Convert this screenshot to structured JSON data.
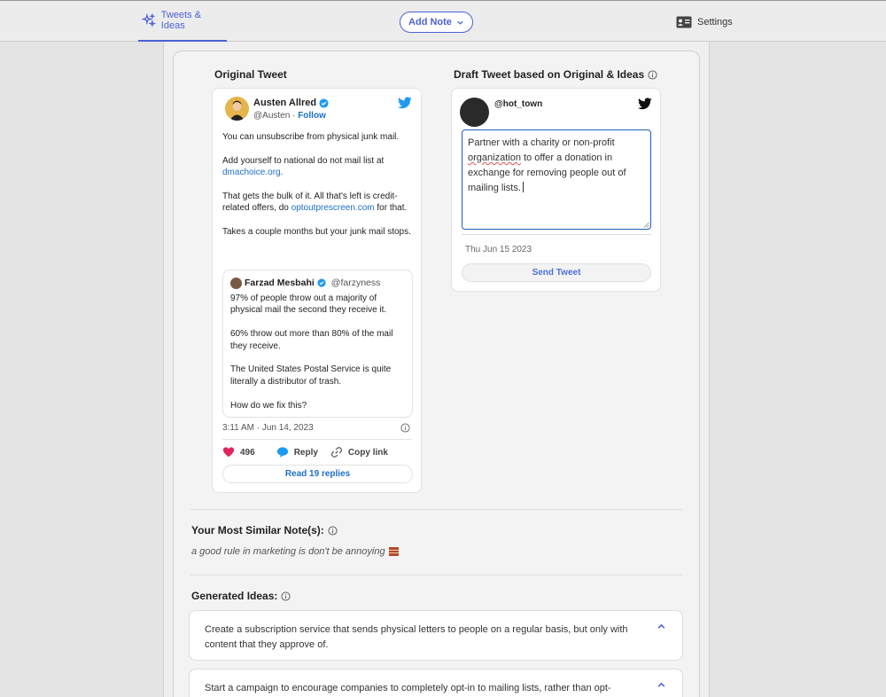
{
  "nav": {
    "tab_label": "Tweets & Ideas",
    "add_note_label": "Add Note",
    "settings_label": "Settings"
  },
  "original": {
    "heading": "Original Tweet",
    "author_name": "Austen Allred",
    "author_handle": "@Austen",
    "follow_label": "Follow",
    "body": {
      "p1": "You can unsubscribe from physical junk mail.",
      "p2_text": "Add yourself to national do not mail list at ",
      "p2_link": "dmachoice.org",
      "p2_end": ".",
      "p3_text": "That gets the bulk of it. All that's left is credit-related offers, do ",
      "p3_link": "optoutprescreen.com",
      "p3_end": " for that.",
      "p4": "Takes a couple months but your junk mail stops."
    },
    "quote": {
      "author_name": "Farzad Mesbahi",
      "author_handle": "@farzyness",
      "p1": "97% of people throw out a majority of physical mail the second they receive it.",
      "p2": "60% throw out more than 80% of the mail they receive.",
      "p3": "The United States Postal Service is quite literally a distributor of trash.",
      "p4": "How do we fix this?"
    },
    "timestamp": "3:11 AM · Jun 14, 2023",
    "likes": "496",
    "reply_label": "Reply",
    "copy_link_label": "Copy link",
    "read_replies_label": "Read 19 replies"
  },
  "draft": {
    "heading": "Draft Tweet based on Original & Ideas",
    "handle": "@hot_town",
    "text_before": "Partner with a charity or non-profit ",
    "text_misspelled": "organization",
    "text_after": " to offer a donation in exchange for removing people out of mailing lists.",
    "date": "Thu Jun 15 2023",
    "send_label": "Send Tweet"
  },
  "notes": {
    "heading": "Your Most Similar Note(s):",
    "items": [
      "a good rule in marketing is don't be annoying"
    ]
  },
  "ideas": {
    "heading": "Generated Ideas:",
    "items": [
      "Create a subscription service that sends physical letters to people on a regular basis, but only with content that they approve of.",
      "Start a campaign to encourage companies to completely opt-in to mailing lists, rather than opt-"
    ]
  },
  "colors": {
    "accent": "#4c60d6",
    "link": "#1d6fc7",
    "like": "#e0245e"
  }
}
